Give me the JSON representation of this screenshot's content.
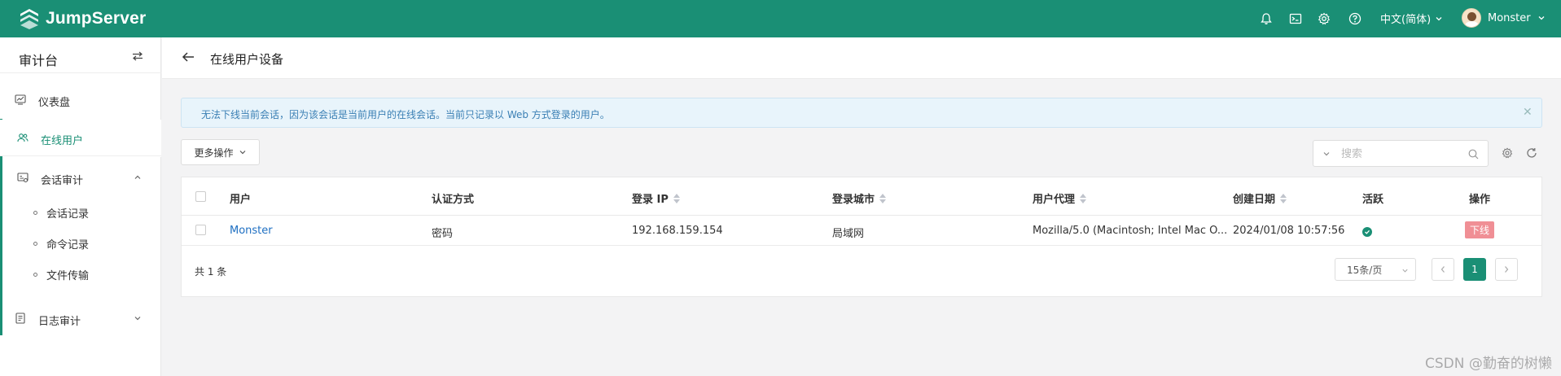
{
  "app": {
    "name": "JumpServer"
  },
  "topbar": {
    "language": "中文(简体)",
    "user_name": "Monster"
  },
  "sidebar": {
    "title": "审计台",
    "items": [
      {
        "label": "仪表盘",
        "icon": "dashboard-icon"
      },
      {
        "label": "在线用户",
        "icon": "users-icon",
        "active": true
      },
      {
        "label": "会话审计",
        "icon": "session-icon",
        "expanded": true,
        "children": [
          {
            "label": "会话记录"
          },
          {
            "label": "命令记录"
          },
          {
            "label": "文件传输"
          }
        ]
      },
      {
        "label": "日志审计",
        "icon": "log-icon",
        "expanded": false
      }
    ]
  },
  "page": {
    "title": "在线用户设备"
  },
  "alert": {
    "text": "无法下线当前会话，因为该会话是当前用户的在线会话。当前只记录以 Web 方式登录的用户。"
  },
  "toolbar": {
    "more_actions": "更多操作",
    "search_placeholder": "搜索"
  },
  "table": {
    "columns": [
      "用户",
      "认证方式",
      "登录 IP",
      "登录城市",
      "用户代理",
      "创建日期",
      "活跃",
      "操作"
    ],
    "rows": [
      {
        "user": "Monster",
        "auth": "密码",
        "ip": "192.168.159.154",
        "city": "局域网",
        "agent": "Mozilla/5.0 (Macintosh; Intel Mac O...",
        "created": "2024/01/08 10:57:56",
        "active": true,
        "action": "下线"
      }
    ]
  },
  "pagination": {
    "total": "共 1 条",
    "page_size": "15条/页",
    "current_page": "1"
  },
  "watermark": "CSDN @勤奋的树懒",
  "colors": {
    "brand": "#1a8f75",
    "link": "#1e6fc2",
    "danger_btn": "#f08f95",
    "alert_bg": "#e8f4fb"
  }
}
